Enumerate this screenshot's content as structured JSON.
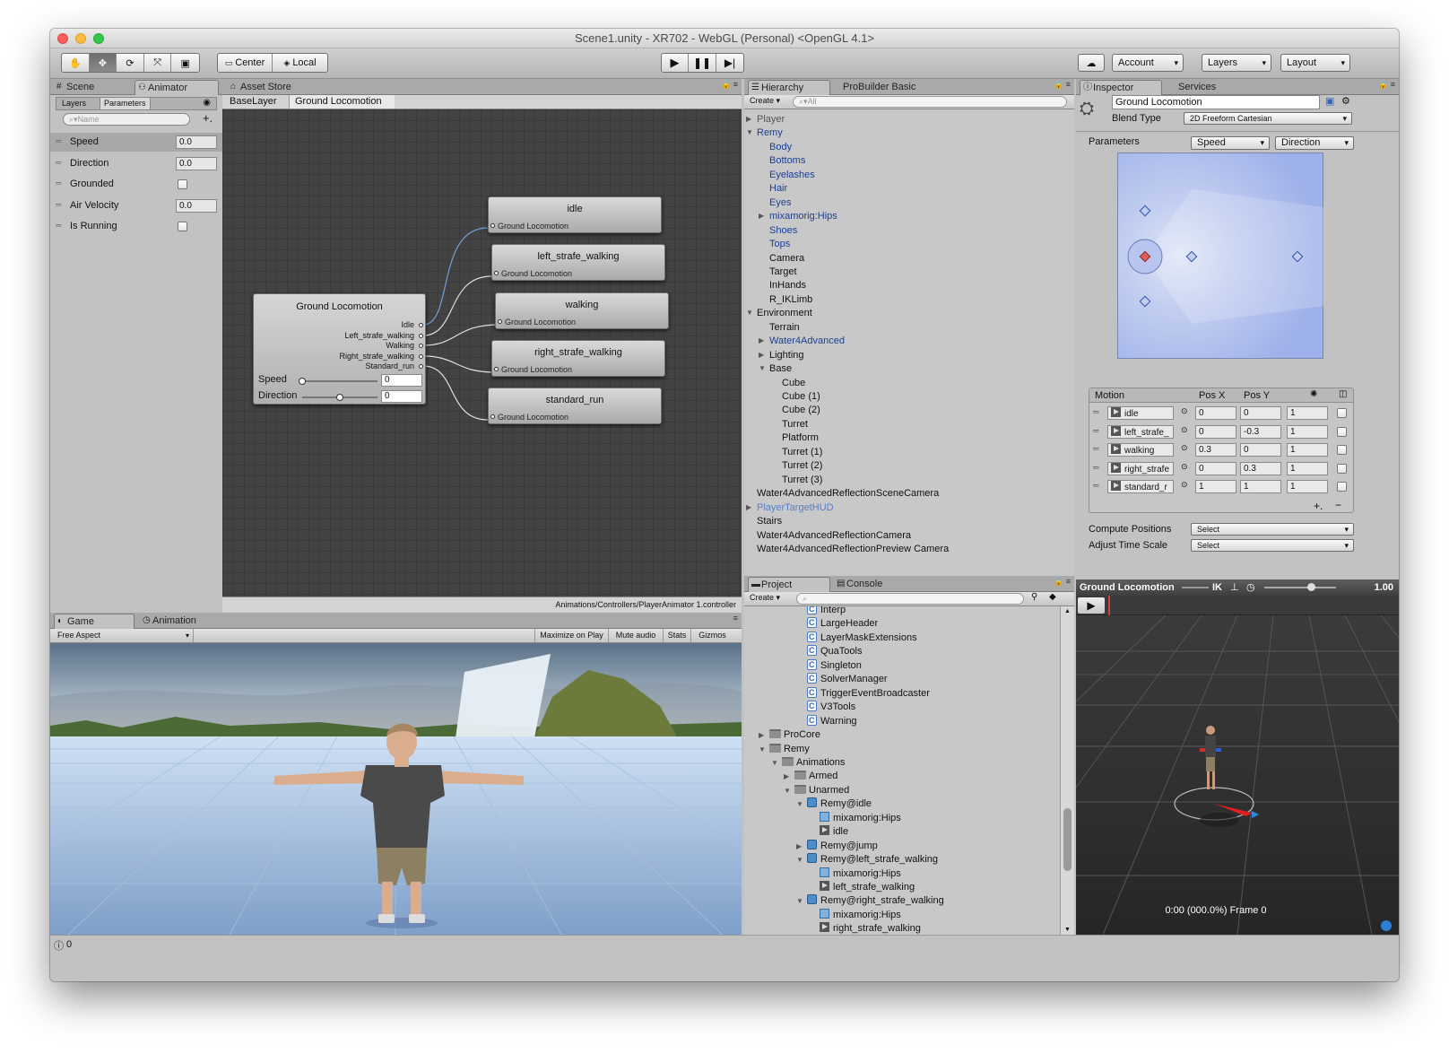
{
  "window": {
    "title": "Scene1.unity - XR702 - WebGL (Personal) <OpenGL 4.1>"
  },
  "toolbar": {
    "center_label": "Center",
    "local_label": "Local",
    "account_label": "Account",
    "layers_label": "Layers",
    "layout_label": "Layout"
  },
  "left_panel": {
    "tab_scene": "Scene",
    "tab_animator": "Animator",
    "tab_asset_store": "Asset Store",
    "subtab_layers": "Layers",
    "subtab_parameters": "Parameters",
    "search_placeholder": "Name",
    "params": [
      {
        "name": "Speed",
        "value": "0.0",
        "type": "float"
      },
      {
        "name": "Direction",
        "value": "0.0",
        "type": "float"
      },
      {
        "name": "Grounded",
        "value": "",
        "type": "bool"
      },
      {
        "name": "Air Velocity",
        "value": "0.0",
        "type": "float"
      },
      {
        "name": "Is Running",
        "value": "",
        "type": "bool"
      }
    ]
  },
  "animator": {
    "breadcrumb": [
      "BaseLayer",
      "Ground Locomotion"
    ],
    "footer_path": "Animations/Controllers/PlayerAnimator 1.controller",
    "blend_node": {
      "title": "Ground Locomotion",
      "outputs": [
        "Idle",
        "Left_strafe_walking",
        "Walking",
        "Right_strafe_walking",
        "Standard_run"
      ],
      "speed_label": "Speed",
      "speed_value": "0",
      "direction_label": "Direction",
      "direction_value": "0",
      "speed_slider": 0.0,
      "direction_slider": 0.5
    },
    "states": [
      {
        "name": "idle",
        "sub": "Ground Locomotion"
      },
      {
        "name": "left_strafe_walking",
        "sub": "Ground Locomotion"
      },
      {
        "name": "walking",
        "sub": "Ground Locomotion"
      },
      {
        "name": "right_strafe_walking",
        "sub": "Ground Locomotion"
      },
      {
        "name": "standard_run",
        "sub": "Ground Locomotion"
      }
    ]
  },
  "game": {
    "tab_game": "Game",
    "tab_animation": "Animation",
    "aspect": "Free Aspect",
    "buttons": [
      "Maximize on Play",
      "Mute audio",
      "Stats",
      "Gizmos"
    ]
  },
  "hierarchy": {
    "tab": "Hierarchy",
    "tab2": "ProBuilder Basic",
    "create_label": "Create",
    "search_placeholder": "All",
    "items": [
      {
        "label": "Player",
        "indent": 0,
        "arrow": "right",
        "blue": false,
        "dim": true
      },
      {
        "label": "Remy",
        "indent": 0,
        "arrow": "down",
        "blue": true
      },
      {
        "label": "Body",
        "indent": 1,
        "blue": true
      },
      {
        "label": "Bottoms",
        "indent": 1,
        "blue": true
      },
      {
        "label": "Eyelashes",
        "indent": 1,
        "blue": true
      },
      {
        "label": "Hair",
        "indent": 1,
        "blue": true
      },
      {
        "label": "Eyes",
        "indent": 1,
        "blue": true
      },
      {
        "label": "mixamorig:Hips",
        "indent": 1,
        "arrow": "right",
        "blue": true
      },
      {
        "label": "Shoes",
        "indent": 1,
        "blue": true
      },
      {
        "label": "Tops",
        "indent": 1,
        "blue": true
      },
      {
        "label": "Camera",
        "indent": 1
      },
      {
        "label": "Target",
        "indent": 1
      },
      {
        "label": "InHands",
        "indent": 1
      },
      {
        "label": "R_IKLimb",
        "indent": 1
      },
      {
        "label": "Environment",
        "indent": 0,
        "arrow": "down"
      },
      {
        "label": "Terrain",
        "indent": 1
      },
      {
        "label": "Water4Advanced",
        "indent": 1,
        "arrow": "right",
        "blue": true
      },
      {
        "label": "Lighting",
        "indent": 1,
        "arrow": "right"
      },
      {
        "label": "Base",
        "indent": 1,
        "arrow": "down"
      },
      {
        "label": "Cube",
        "indent": 2
      },
      {
        "label": "Cube (1)",
        "indent": 2
      },
      {
        "label": "Cube (2)",
        "indent": 2
      },
      {
        "label": "Turret",
        "indent": 2
      },
      {
        "label": "Platform",
        "indent": 2
      },
      {
        "label": "Turret (1)",
        "indent": 2
      },
      {
        "label": "Turret (2)",
        "indent": 2
      },
      {
        "label": "Turret (3)",
        "indent": 2
      },
      {
        "label": "Water4AdvancedReflectionSceneCamera",
        "indent": 0
      },
      {
        "label": "PlayerTargetHUD",
        "indent": 0,
        "arrow": "right",
        "lightblue": true
      },
      {
        "label": "Stairs",
        "indent": 0
      },
      {
        "label": "Water4AdvancedReflectionCamera",
        "indent": 0
      },
      {
        "label": "Water4AdvancedReflectionPreview Camera",
        "indent": 0
      }
    ]
  },
  "project": {
    "tab": "Project",
    "tab2": "Console",
    "create_label": "Create",
    "items": [
      {
        "label": "Interp",
        "indent": 4,
        "icon": "script"
      },
      {
        "label": "LargeHeader",
        "indent": 4,
        "icon": "script"
      },
      {
        "label": "LayerMaskExtensions",
        "indent": 4,
        "icon": "script"
      },
      {
        "label": "QuaTools",
        "indent": 4,
        "icon": "script"
      },
      {
        "label": "Singleton",
        "indent": 4,
        "icon": "script"
      },
      {
        "label": "SolverManager",
        "indent": 4,
        "icon": "script"
      },
      {
        "label": "TriggerEventBroadcaster",
        "indent": 4,
        "icon": "script"
      },
      {
        "label": "V3Tools",
        "indent": 4,
        "icon": "script"
      },
      {
        "label": "Warning",
        "indent": 4,
        "icon": "script"
      },
      {
        "label": "ProCore",
        "indent": 1,
        "icon": "folder",
        "arrow": "right"
      },
      {
        "label": "Remy",
        "indent": 1,
        "icon": "folder",
        "arrow": "down"
      },
      {
        "label": "Animations",
        "indent": 2,
        "icon": "folder",
        "arrow": "down"
      },
      {
        "label": "Armed",
        "indent": 3,
        "icon": "folder",
        "arrow": "right"
      },
      {
        "label": "Unarmed",
        "indent": 3,
        "icon": "folder",
        "arrow": "down"
      },
      {
        "label": "Remy@idle",
        "indent": 4,
        "icon": "cube",
        "arrow": "down"
      },
      {
        "label": "mixamorig:Hips",
        "indent": 5,
        "icon": "mesh"
      },
      {
        "label": "idle",
        "indent": 5,
        "icon": "anim"
      },
      {
        "label": "Remy@jump",
        "indent": 4,
        "icon": "cube",
        "arrow": "right"
      },
      {
        "label": "Remy@left_strafe_walking",
        "indent": 4,
        "icon": "cube",
        "arrow": "down"
      },
      {
        "label": "mixamorig:Hips",
        "indent": 5,
        "icon": "mesh"
      },
      {
        "label": "left_strafe_walking",
        "indent": 5,
        "icon": "anim"
      },
      {
        "label": "Remy@right_strafe_walking",
        "indent": 4,
        "icon": "cube",
        "arrow": "down"
      },
      {
        "label": "mixamorig:Hips",
        "indent": 5,
        "icon": "mesh"
      },
      {
        "label": "right_strafe_walking",
        "indent": 5,
        "icon": "anim"
      }
    ]
  },
  "inspector": {
    "tab": "Inspector",
    "tab2": "Services",
    "object_name": "Ground Locomotion",
    "blend_type_label": "Blend Type",
    "blend_type_value": "2D Freeform Cartesian",
    "parameters_label": "Parameters",
    "param_x": "Speed",
    "param_y": "Direction",
    "motion_header": {
      "motion": "Motion",
      "posx": "Pos X",
      "posy": "Pos Y"
    },
    "motions": [
      {
        "name": "idle",
        "posx": "0",
        "posy": "0",
        "speed": "1"
      },
      {
        "name": "left_strafe_",
        "posx": "0",
        "posy": "-0.3",
        "speed": "1"
      },
      {
        "name": "walking",
        "posx": "0.3",
        "posy": "0",
        "speed": "1"
      },
      {
        "name": "right_strafe",
        "posx": "0",
        "posy": "0.3",
        "speed": "1"
      },
      {
        "name": "standard_r",
        "posx": "1",
        "posy": "1",
        "speed": "1"
      }
    ],
    "compute_positions_label": "Compute Positions",
    "compute_positions_value": "Select",
    "adjust_time_label": "Adjust Time Scale",
    "adjust_time_value": "Select"
  },
  "preview": {
    "title": "Ground Locomotion",
    "ik_label": "IK",
    "speed_value": "1.00",
    "time_label": "0:00 (000.0%) Frame 0"
  },
  "status": {
    "count": "0"
  },
  "colors": {
    "accent_blue": "#4a79c8",
    "node_link": "#6f9fd6",
    "hier_blue": "#1a3f93"
  }
}
